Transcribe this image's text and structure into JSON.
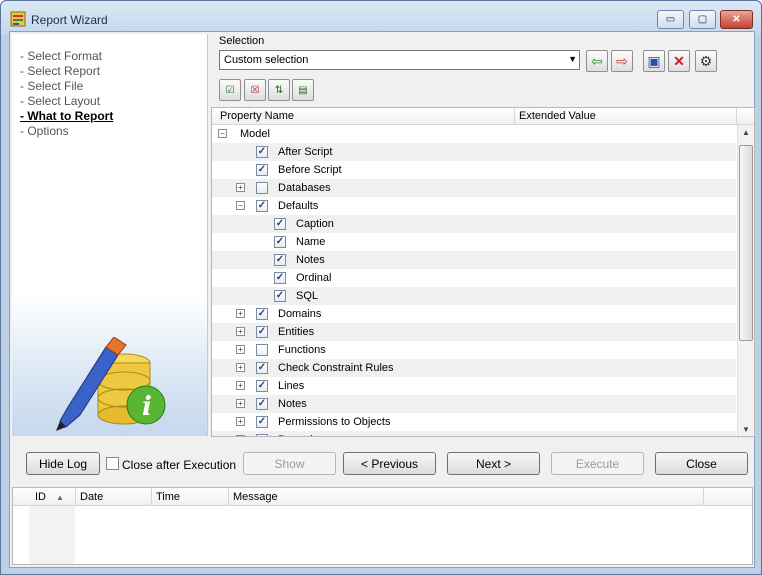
{
  "window": {
    "title": "Report Wizard",
    "min_symbol": "▭",
    "max_symbol": "▢",
    "close_symbol": "✕"
  },
  "steps": [
    {
      "label": "- Select Format",
      "active": false
    },
    {
      "label": "- Select Report",
      "active": false
    },
    {
      "label": "- Select File",
      "active": false
    },
    {
      "label": "- Select Layout",
      "active": false
    },
    {
      "label": "- What to Report",
      "active": true
    },
    {
      "label": "- Options",
      "active": false
    }
  ],
  "selection": {
    "label": "Selection",
    "value": "Custom selection"
  },
  "grid": {
    "columns": [
      "Property Name",
      "Extended Value"
    ],
    "rows": [
      {
        "label": "Model",
        "level": 0,
        "expander": "minus",
        "checkbox": "none"
      },
      {
        "label": "After Script",
        "level": 1,
        "expander": "none",
        "checkbox": "checked"
      },
      {
        "label": "Before Script",
        "level": 1,
        "expander": "none",
        "checkbox": "checked"
      },
      {
        "label": "Databases",
        "level": 1,
        "expander": "plus",
        "checkbox": "unchecked"
      },
      {
        "label": "Defaults",
        "level": 1,
        "expander": "minus",
        "checkbox": "checked"
      },
      {
        "label": "Caption",
        "level": 2,
        "expander": "none",
        "checkbox": "checked"
      },
      {
        "label": "Name",
        "level": 2,
        "expander": "none",
        "checkbox": "checked"
      },
      {
        "label": "Notes",
        "level": 2,
        "expander": "none",
        "checkbox": "checked"
      },
      {
        "label": "Ordinal",
        "level": 2,
        "expander": "none",
        "checkbox": "checked"
      },
      {
        "label": "SQL",
        "level": 2,
        "expander": "none",
        "checkbox": "checked"
      },
      {
        "label": "Domains",
        "level": 1,
        "expander": "plus",
        "checkbox": "checked"
      },
      {
        "label": "Entities",
        "level": 1,
        "expander": "plus",
        "checkbox": "checked"
      },
      {
        "label": "Functions",
        "level": 1,
        "expander": "plus",
        "checkbox": "unchecked"
      },
      {
        "label": "Check Constraint Rules",
        "level": 1,
        "expander": "plus",
        "checkbox": "checked"
      },
      {
        "label": "Lines",
        "level": 1,
        "expander": "plus",
        "checkbox": "checked"
      },
      {
        "label": "Notes",
        "level": 1,
        "expander": "plus",
        "checkbox": "checked"
      },
      {
        "label": "Permissions to Objects",
        "level": 1,
        "expander": "plus",
        "checkbox": "checked"
      },
      {
        "label": "Procedures",
        "level": 1,
        "expander": "plus",
        "checkbox": "unchecked"
      }
    ]
  },
  "buttons": {
    "hide_log": "Hide Log",
    "close_after": "Close after Execution",
    "show": "Show",
    "previous": "< Previous",
    "next": "Next >",
    "execute": "Execute",
    "close": "Close"
  },
  "log": {
    "columns": [
      "ID",
      "Date",
      "Time",
      "Message"
    ]
  },
  "colors": {
    "accent": "#2b3f72",
    "frame": "#bcd0e6"
  }
}
